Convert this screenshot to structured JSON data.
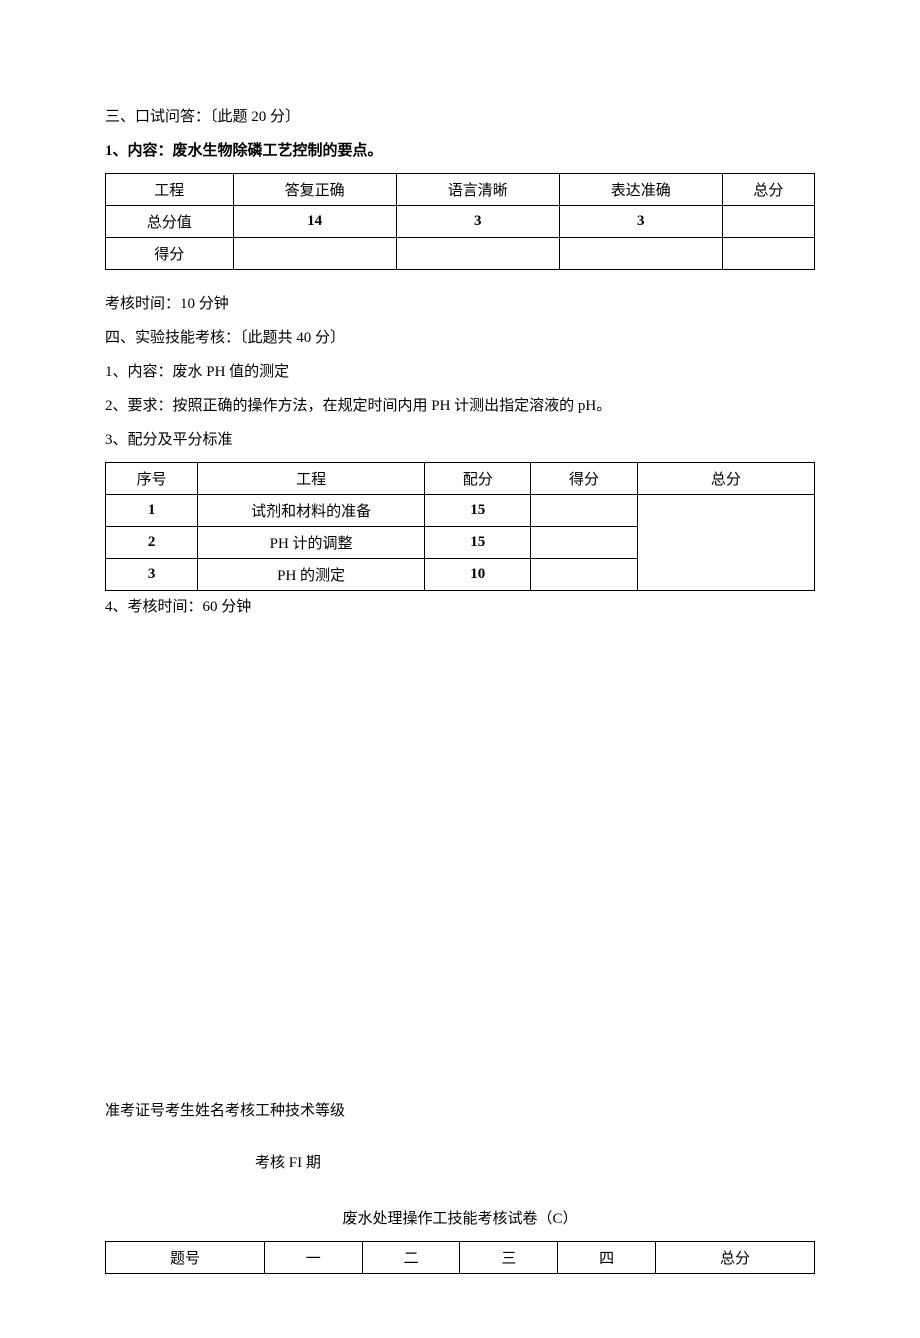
{
  "section3": {
    "heading": "三、口试问答：〔此题 20 分〕",
    "content_line": "1、内容：废水生物除磷工艺控制的要点。",
    "table": {
      "headers": [
        "工程",
        "答复正确",
        "语言清晰",
        "表达准确",
        "总分"
      ],
      "rows": [
        [
          "总分值",
          "14",
          "3",
          "3",
          ""
        ],
        [
          "得分",
          "",
          "",
          "",
          ""
        ]
      ]
    },
    "time_line": "考核时间：10 分钟"
  },
  "section4": {
    "heading": "四、实验技能考核：〔此题共 40 分〕",
    "line1": "1、内容：废水 PH 值的测定",
    "line2": "2、要求：按照正确的操作方法，在规定时间内用 PH 计测出指定溶液的 pH。",
    "line3": "3、配分及平分标准",
    "table": {
      "headers": [
        "序号",
        "工程",
        "配分",
        "得分",
        "总分"
      ],
      "rows": [
        [
          "1",
          "试剂和材料的准备",
          "15",
          "",
          ""
        ],
        [
          "2",
          "PH 计的调整",
          "15",
          "",
          ""
        ],
        [
          "3",
          "PH 的测定",
          "10",
          "",
          ""
        ]
      ]
    },
    "time_line": "4、考核时间：60 分钟"
  },
  "footer": {
    "info_line": "准考证号考生姓名考核工种技术等级",
    "exam_date": "考核 FI 期",
    "title": "废水处理操作工技能考核试卷（C）",
    "table": {
      "headers": [
        "题号",
        "一",
        "二",
        "三",
        "四",
        "总分"
      ]
    }
  }
}
